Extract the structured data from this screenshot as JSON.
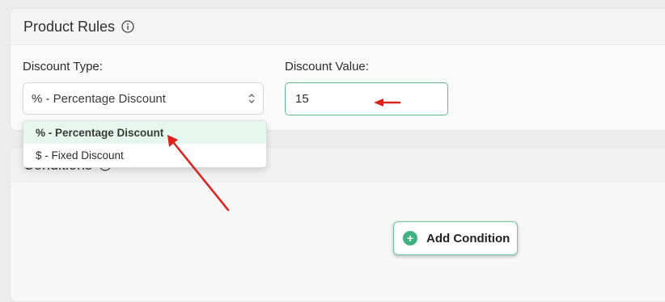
{
  "product_rules": {
    "title": "Product Rules",
    "discount_type_label": "Discount Type:",
    "discount_type_selected": "% - Percentage Discount",
    "discount_value_label": "Discount Value:",
    "discount_value": "15"
  },
  "dropdown": {
    "options": [
      {
        "label": "% - Percentage Discount",
        "selected": true
      },
      {
        "label": "$ - Fixed Discount",
        "selected": false
      }
    ]
  },
  "conditions": {
    "title": "Conditions",
    "add_condition_label": "Add Condition"
  },
  "colors": {
    "accent_green": "#3fb27f",
    "selected_option_bg": "#e6f7ee",
    "annotation_arrow": "#e0201b"
  },
  "icons": {
    "info": "info-icon",
    "select_caret": "chevron-up-down-icon",
    "add": "plus-circle-icon"
  }
}
